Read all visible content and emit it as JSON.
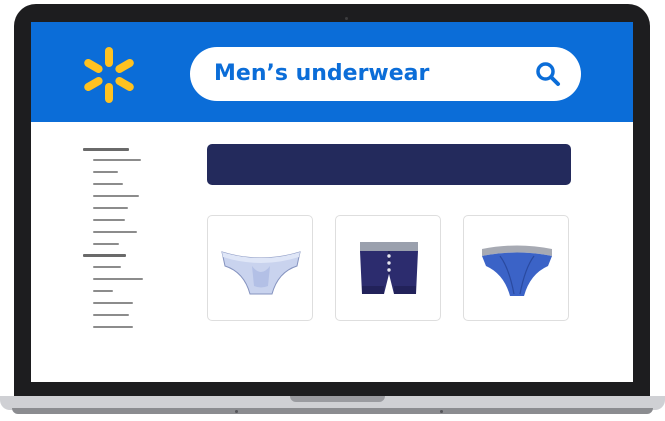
{
  "header": {
    "logo_icon": "walmart-spark-icon",
    "search": {
      "value": "Men’s underwear",
      "icon": "search-icon"
    }
  },
  "colors": {
    "brand_blue": "#0b6dd8",
    "logo_yellow": "#ffc220",
    "banner_navy": "#232a5c",
    "bezel": "#1d1d1f"
  },
  "products": [
    {
      "icon": "white-briefs-icon"
    },
    {
      "icon": "navy-boxer-briefs-icon"
    },
    {
      "icon": "blue-briefs-icon"
    }
  ]
}
